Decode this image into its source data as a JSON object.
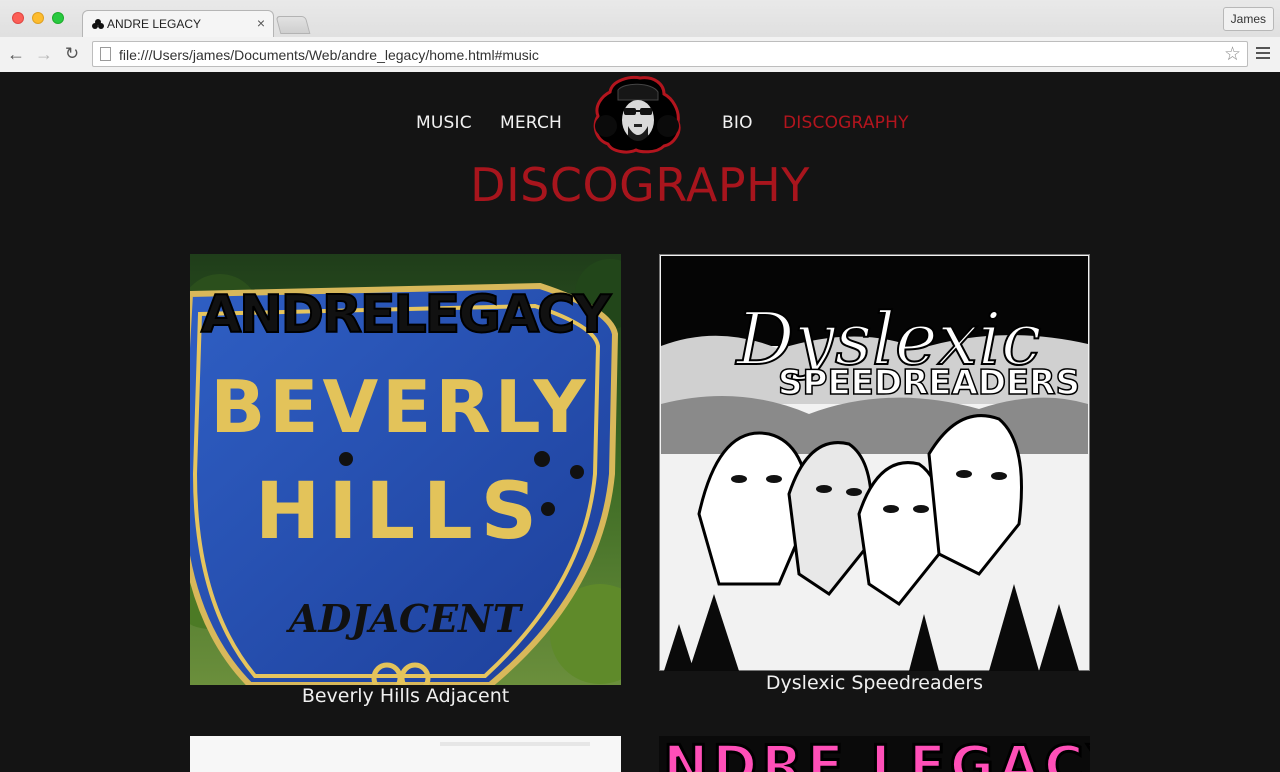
{
  "browser": {
    "tab_title": "ANDRE LEGACY",
    "tab_close": "×",
    "profile_name": "James",
    "url": "file:///Users/james/Documents/Web/andre_legacy/home.html#music"
  },
  "nav": {
    "items": [
      {
        "label": "MUSIC"
      },
      {
        "label": "MERCH"
      },
      {
        "label": "BIO"
      },
      {
        "label": "DISCOGRAPHY"
      }
    ],
    "active_color": "#b3151e"
  },
  "page": {
    "heading": "DISCOGRAPHY",
    "accent_color": "#a8151d"
  },
  "albums": [
    {
      "title": "Beverly Hills Adjacent",
      "art_text_top": "ANDRELEGACY",
      "art_text_1": "BEVERLY",
      "art_text_2": "HILLS",
      "art_text_3": "ADJACENT"
    },
    {
      "title": "Dyslexic Speedreaders",
      "art_text_top": "Dyslexic",
      "art_text_2": "SPEEDREADERS"
    }
  ],
  "bottom_art_text": "ANDRE LEGACY"
}
